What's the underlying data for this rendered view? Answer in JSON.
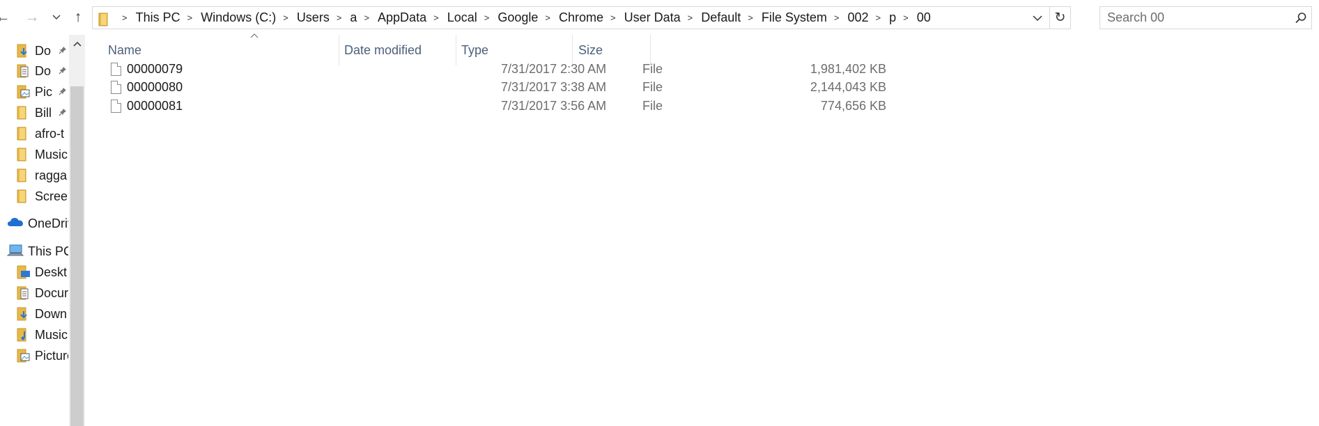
{
  "nav_buttons": {
    "back_glyph": "←",
    "forward_glyph": "→",
    "recent_glyph": "⌄",
    "up_glyph": "↑"
  },
  "address": {
    "breadcrumbs": [
      "This PC",
      "Windows (C:)",
      "Users",
      "a",
      "AppData",
      "Local",
      "Google",
      "Chrome",
      "User Data",
      "Default",
      "File System",
      "002",
      "p",
      "00"
    ],
    "separator": ">",
    "dropdown_glyph": "⌄",
    "refresh_glyph": "↻"
  },
  "search": {
    "placeholder": "Search 00"
  },
  "navpane": {
    "items": [
      {
        "label": "Do",
        "icon": "downloads-folder-icon",
        "pinned": true
      },
      {
        "label": "Do",
        "icon": "documents-folder-icon",
        "pinned": true
      },
      {
        "label": "Pic",
        "icon": "pictures-folder-icon",
        "pinned": true
      },
      {
        "label": "Bill",
        "icon": "folder-icon",
        "pinned": true
      },
      {
        "label": "afro-t",
        "icon": "folder-icon",
        "pinned": false
      },
      {
        "label": "Music",
        "icon": "folder-icon",
        "pinned": false
      },
      {
        "label": "ragga",
        "icon": "folder-icon",
        "pinned": false
      },
      {
        "label": "Screen",
        "icon": "folder-icon",
        "pinned": false
      },
      {
        "label": "OneDriv",
        "icon": "onedrive-cloud-icon",
        "pinned": false
      },
      {
        "label": "This PC",
        "icon": "this-pc-icon",
        "pinned": false
      },
      {
        "label": "Deskt",
        "icon": "desktop-folder-icon",
        "pinned": false
      },
      {
        "label": "Docur",
        "icon": "documents-folder-icon",
        "pinned": false
      },
      {
        "label": "Down",
        "icon": "downloads-folder-icon",
        "pinned": false
      },
      {
        "label": "Music",
        "icon": "music-folder-icon",
        "pinned": false
      },
      {
        "label": "Picture",
        "icon": "pictures-folder-icon",
        "pinned": false
      }
    ],
    "pin_glyph": "📌"
  },
  "columns": {
    "name": "Name",
    "date": "Date modified",
    "type": "Type",
    "size": "Size"
  },
  "files": [
    {
      "name": "00000079",
      "date": "7/31/2017 2:30 AM",
      "type": "File",
      "size": "1,981,402 KB"
    },
    {
      "name": "00000080",
      "date": "7/31/2017 3:38 AM",
      "type": "File",
      "size": "2,144,043 KB"
    },
    {
      "name": "00000081",
      "date": "7/31/2017 3:56 AM",
      "type": "File",
      "size": "774,656 KB"
    }
  ],
  "colors": {
    "folder_yellow": "#e8b947",
    "header_text": "#4c607a",
    "onedrive_blue": "#1e6fd0"
  }
}
